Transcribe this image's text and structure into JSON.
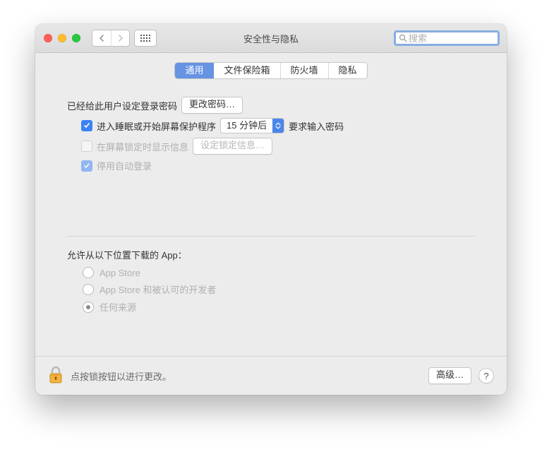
{
  "window": {
    "title": "安全性与隐私",
    "search_placeholder": "搜索"
  },
  "tabs": [
    "通用",
    "文件保险箱",
    "防火墙",
    "隐私"
  ],
  "general": {
    "password_set_label": "已经给此用户设定登录密码",
    "change_password_btn": "更改密码…",
    "require_password_label": "进入睡眠或开始屏幕保护程序",
    "require_password_delay": "15 分钟后",
    "require_password_suffix": "要求输入密码",
    "show_message_label": "在屏幕锁定时显示信息",
    "set_lock_message_btn": "设定锁定信息…",
    "disable_auto_login_label": "停用自动登录"
  },
  "download": {
    "title": "允许从以下位置下载的 App：",
    "options": [
      "App Store",
      "App Store 和被认可的开发者",
      "任何来源"
    ]
  },
  "footer": {
    "lock_text": "点按锁按钮以进行更改。",
    "advanced_btn": "高级…",
    "help": "?"
  }
}
